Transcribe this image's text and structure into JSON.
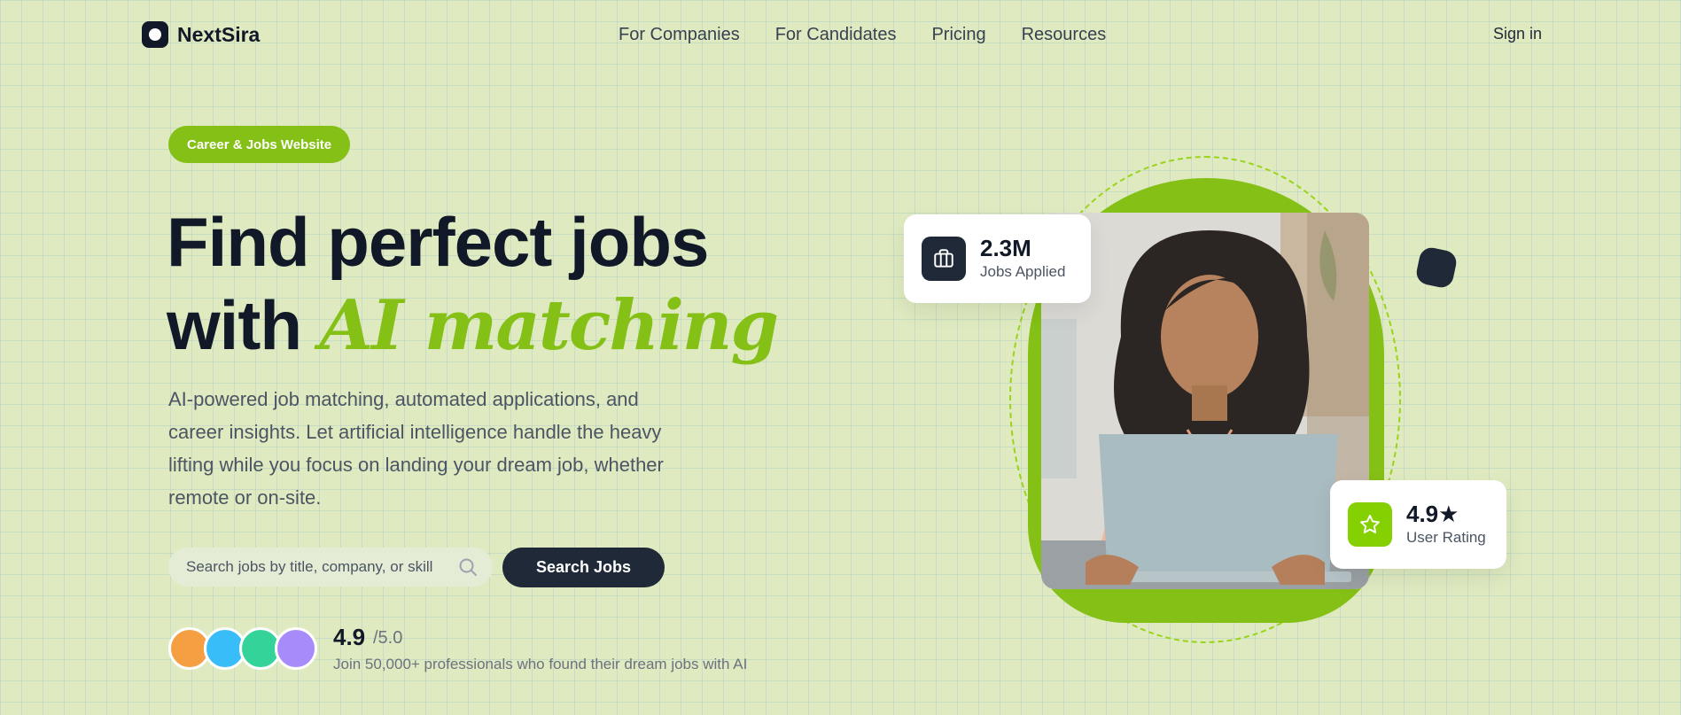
{
  "header": {
    "brand": "NextSira",
    "nav": [
      "For Companies",
      "For Candidates",
      "Pricing",
      "Resources"
    ],
    "signin": "Sign in"
  },
  "hero": {
    "badge": "Career & Jobs Website",
    "headline_line1": "Find perfect jobs",
    "headline_line2_prefix": "with",
    "headline_accent": "AI matching",
    "description": "AI-powered job matching, automated applications, and career insights. Let artificial intelligence handle the heavy lifting while you focus on landing your dream job, whether remote or on-site.",
    "search": {
      "placeholder": "Search jobs by title, company, or skill",
      "button": "Search Jobs"
    },
    "rating": {
      "value": "4.9",
      "out_of": "/5.0",
      "subtext": "Join 50,000+ professionals who found their dream jobs with AI"
    },
    "avatar_colors": [
      "#f59e42",
      "#38bdf8",
      "#34d399",
      "#a78bfa"
    ]
  },
  "stats": {
    "applied": {
      "value": "2.3M",
      "label": "Jobs Applied",
      "icon": "briefcase-icon"
    },
    "user_rating": {
      "value": "4.9★",
      "label": "User Rating",
      "icon": "star-icon"
    }
  },
  "colors": {
    "accent": "#84c015",
    "dark": "#1f2937",
    "background": "#dfeac1"
  }
}
